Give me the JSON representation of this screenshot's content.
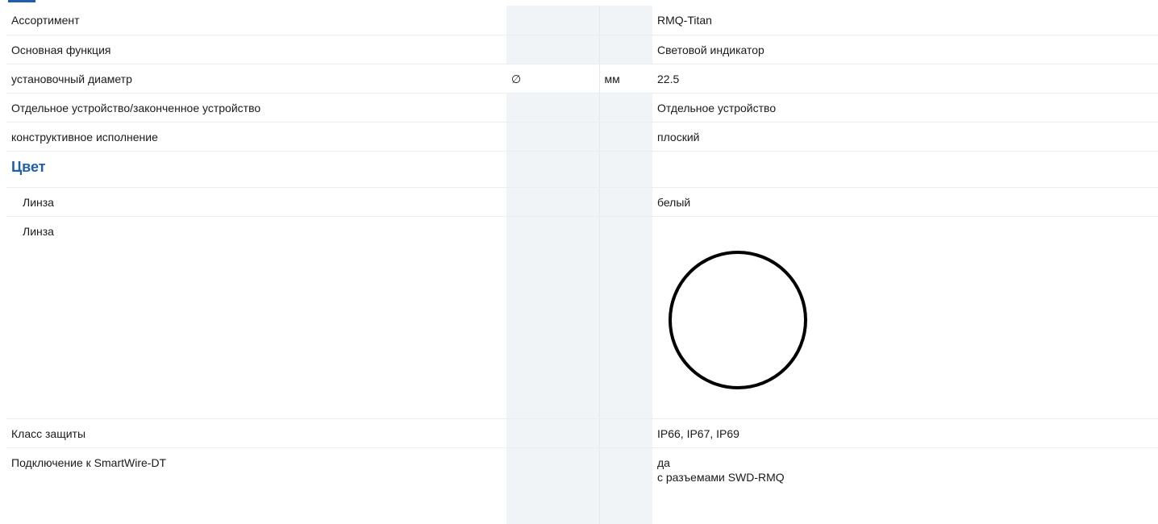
{
  "rows": [
    {
      "label": "Ассортимент",
      "symbol": "",
      "unit": "",
      "value": "RMQ-Titan"
    },
    {
      "label": "Основная функция",
      "symbol": "",
      "unit": "",
      "value": "Световой индикатор"
    },
    {
      "label": "установочный диаметр",
      "symbol": "∅",
      "unit": "мм",
      "value": "22.5"
    },
    {
      "label": "Отдельное устройство/законченное устройство",
      "symbol": "",
      "unit": "",
      "value": "Отдельное устройство"
    },
    {
      "label": "конструктивное исполнение",
      "symbol": "",
      "unit": "",
      "value": "плоский"
    }
  ],
  "section": {
    "title": "Цвет"
  },
  "color_rows": [
    {
      "label": "Линза",
      "value": "белый"
    },
    {
      "label": "Линза",
      "value_icon": "white-lens-circle-icon"
    }
  ],
  "bottom_rows": [
    {
      "label": "Класс защиты",
      "value": "IP66, IP67, IP69"
    },
    {
      "label": "Подключение к SmartWire-DT",
      "value_line1": "да",
      "value_line2": "с разъемами SWD-RMQ"
    }
  ],
  "colors": {
    "accent": "#1f5fae",
    "shaded_column": "#f1f4f7",
    "row_divider": "#e9eef3"
  }
}
